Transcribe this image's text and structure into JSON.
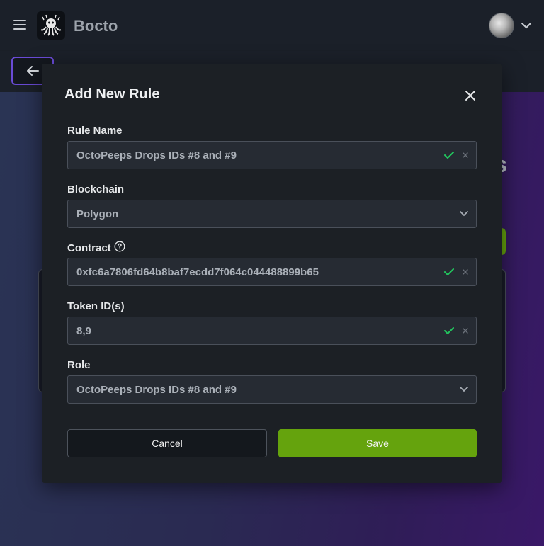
{
  "app": {
    "brand": "Bocto"
  },
  "modal": {
    "title": "Add New Rule",
    "fields": {
      "rule_name": {
        "label": "Rule Name",
        "value": "OctoPeeps Drops IDs #8 and #9"
      },
      "blockchain": {
        "label": "Blockchain",
        "value": "Polygon"
      },
      "contract": {
        "label": "Contract",
        "value": "0xfc6a7806fd64b8baf7ecdd7f064c044488899b65"
      },
      "token_ids": {
        "label": "Token ID(s)",
        "value": "8,9"
      },
      "role": {
        "label": "Role",
        "value": "OctoPeeps Drops IDs #8 and #9"
      }
    },
    "buttons": {
      "cancel": "Cancel",
      "save": "Save"
    }
  },
  "background": {
    "heading_fragment": "s"
  },
  "colors": {
    "accent_green": "#65a30d",
    "check_green": "#22c55e",
    "back_button_border": "#6a4bd6",
    "modal_bg": "#1c2025"
  },
  "icons": [
    "menu-icon",
    "logo-icon",
    "avatar",
    "chevron-down-icon",
    "arrow-left-icon",
    "close-icon",
    "check-icon",
    "clear-icon",
    "help-icon"
  ]
}
